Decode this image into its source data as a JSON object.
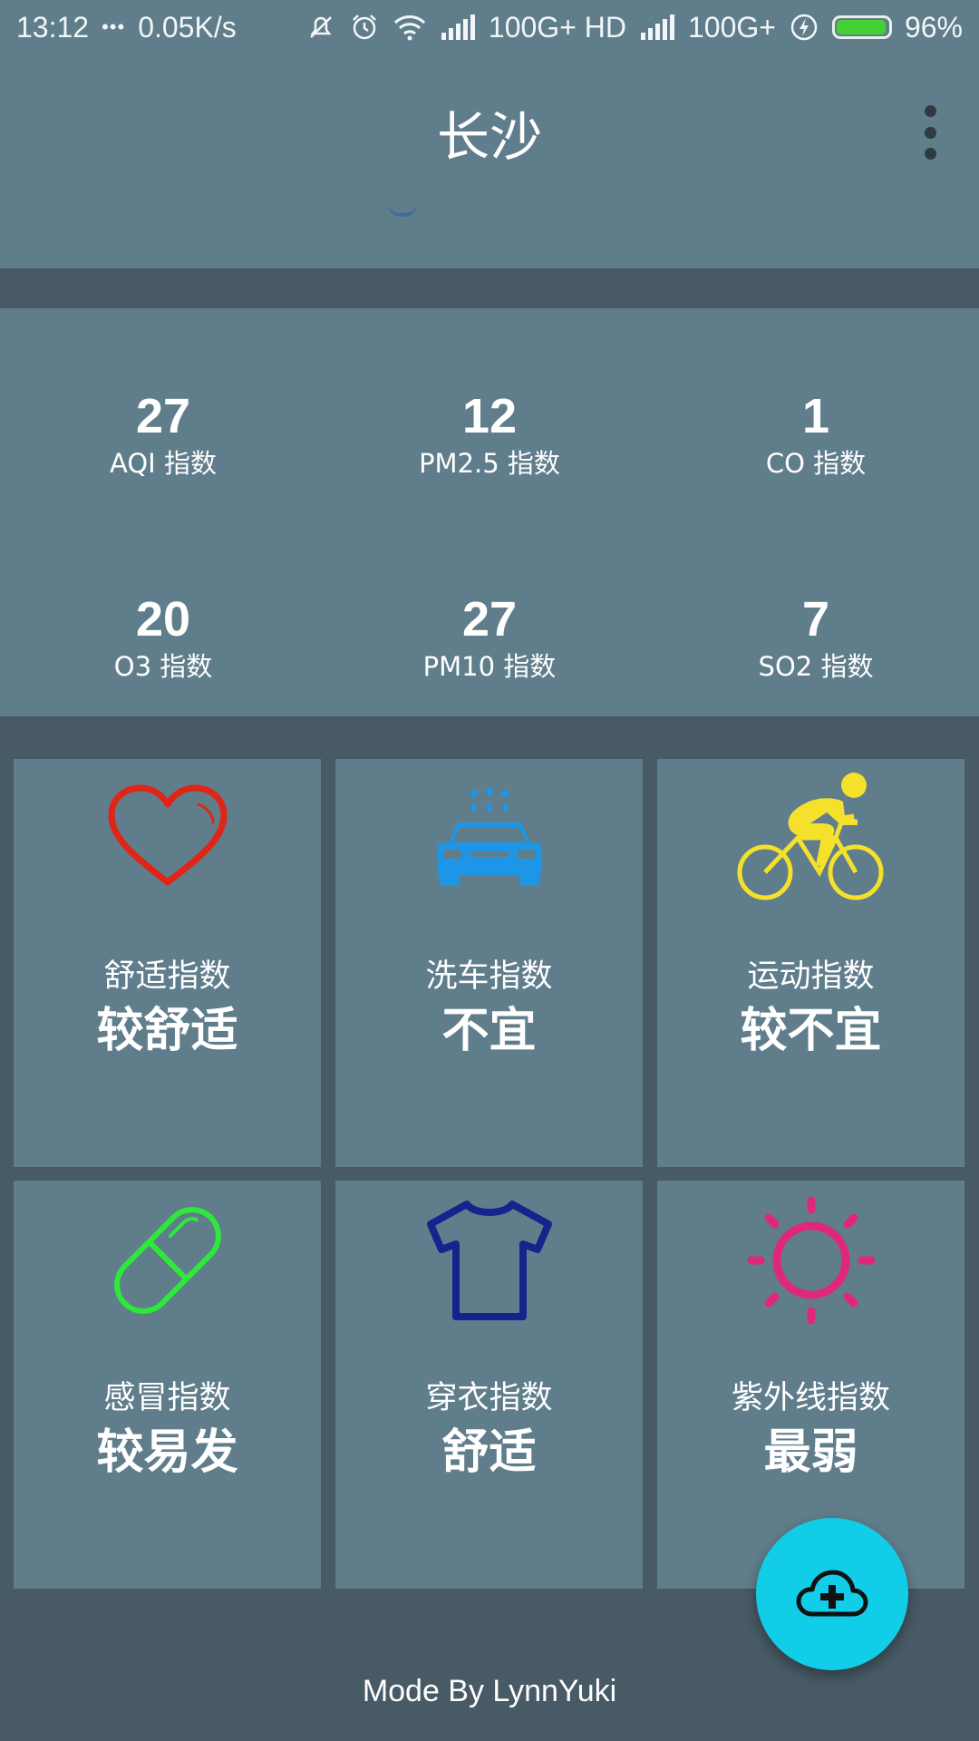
{
  "status_bar": {
    "time": "13:12",
    "dots": "•••",
    "network_speed": "0.05K/s",
    "sim1": "100G+ HD",
    "sim2": "100G+",
    "battery": "96%",
    "icons": [
      "mute-icon",
      "alarm-icon",
      "wifi-icon",
      "signal-icon",
      "charging-icon",
      "battery-icon"
    ],
    "battery_level": 0.96
  },
  "header": {
    "city": "长沙",
    "menu_icon": "more-vert-icon"
  },
  "air_quality": [
    {
      "value": "27",
      "label": "AQI 指数"
    },
    {
      "value": "12",
      "label": "PM2.5 指数"
    },
    {
      "value": "1",
      "label": "CO 指数"
    },
    {
      "value": "20",
      "label": "O3 指数"
    },
    {
      "value": "27",
      "label": "PM10 指数"
    },
    {
      "value": "7",
      "label": "SO2 指数"
    }
  ],
  "life_indices": [
    {
      "title": "舒适指数",
      "value": "较舒适",
      "icon": "heart-icon",
      "color": "#e02416"
    },
    {
      "title": "洗车指数",
      "value": "不宜",
      "icon": "car-wash-icon",
      "color": "#1e96e8"
    },
    {
      "title": "运动指数",
      "value": "较不宜",
      "icon": "cyclist-icon",
      "color": "#f5e12c"
    },
    {
      "title": "感冒指数",
      "value": "较易发",
      "icon": "pill-icon",
      "color": "#2ee83a"
    },
    {
      "title": "穿衣指数",
      "value": "舒适",
      "icon": "tshirt-icon",
      "color": "#14248c"
    },
    {
      "title": "紫外线指数",
      "value": "最弱",
      "icon": "sun-icon",
      "color": "#e0287a"
    }
  ],
  "fab": {
    "icon": "cloud-add-icon",
    "color": "#12cde8"
  },
  "footer": {
    "credit": "Mode By LynnYuki"
  },
  "colors": {
    "primary": "#607d8b",
    "background": "#475a65"
  }
}
